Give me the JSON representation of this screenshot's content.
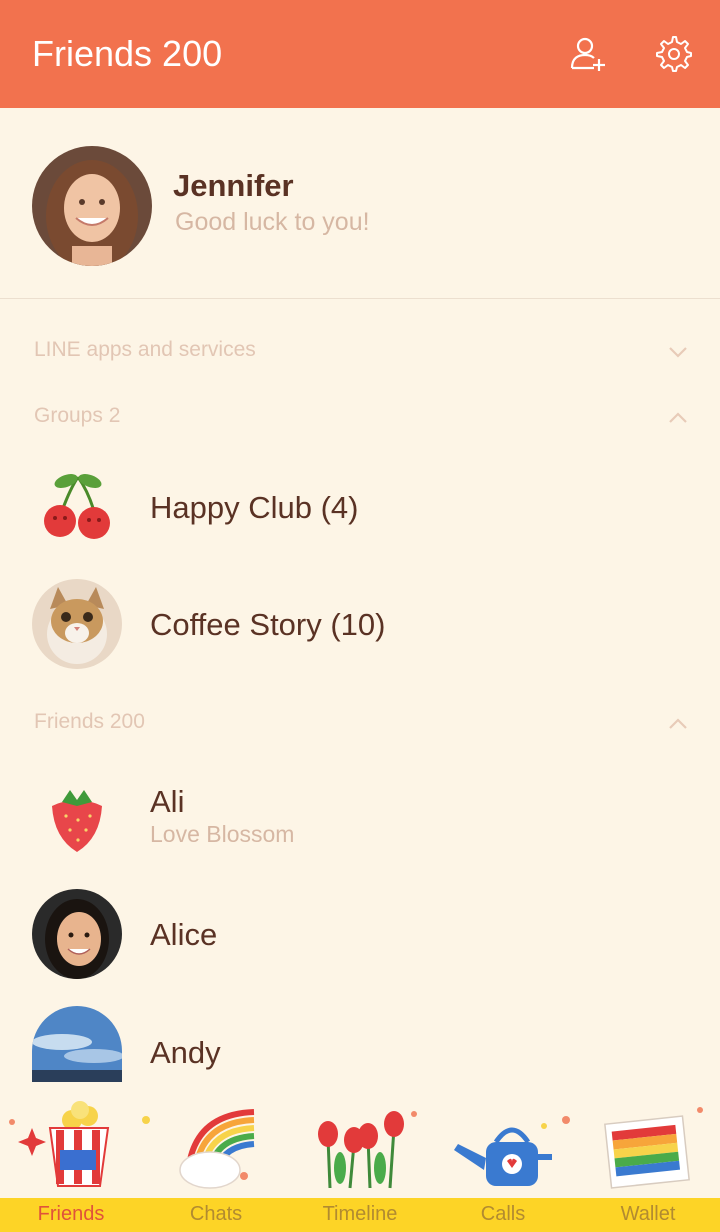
{
  "header": {
    "title": "Friends 200"
  },
  "profile": {
    "name": "Jennifer",
    "status": "Good luck to you!"
  },
  "sections": {
    "services": "LINE apps and services",
    "groups": "Groups 2",
    "friends": "Friends 200"
  },
  "groups": [
    {
      "name": "Happy Club (4)",
      "icon": "cherries"
    },
    {
      "name": "Coffee Story (10)",
      "icon": "cat"
    }
  ],
  "friends": [
    {
      "name": "Ali",
      "status": "Love Blossom",
      "icon": "strawberry"
    },
    {
      "name": "Alice",
      "status": "",
      "icon": "person"
    },
    {
      "name": "Andy",
      "status": "",
      "icon": "sky"
    }
  ],
  "tabs": [
    {
      "label": "Friends",
      "active": true
    },
    {
      "label": "Chats",
      "active": false
    },
    {
      "label": "Timeline",
      "active": false
    },
    {
      "label": "Calls",
      "active": false
    },
    {
      "label": "Wallet",
      "active": false
    }
  ],
  "colors": {
    "header": "#f2724e",
    "background": "#fdf5e6",
    "tabbar": "#fdd426",
    "active_tab": "#e0533a"
  }
}
